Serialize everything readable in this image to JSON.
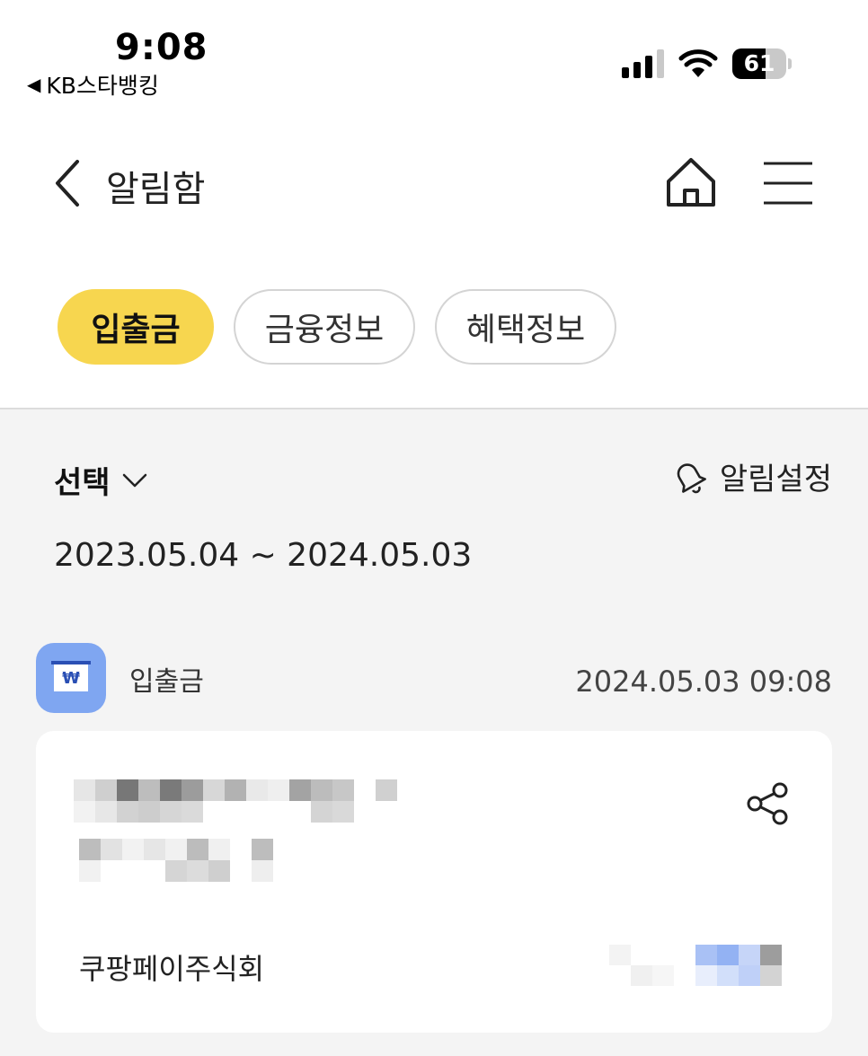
{
  "status_bar": {
    "time": "9:08",
    "back_app_label": "KB스타뱅킹",
    "battery_percent": "61",
    "signal_bars": 3,
    "icons": [
      "signal-icon",
      "wifi-icon",
      "battery-icon"
    ]
  },
  "header": {
    "title": "알림함",
    "icons": [
      "back-chevron-icon",
      "home-icon",
      "menu-icon"
    ]
  },
  "tabs": [
    {
      "label": "입출금",
      "active": true
    },
    {
      "label": "금융정보",
      "active": false
    },
    {
      "label": "혜택정보",
      "active": false
    }
  ],
  "filter": {
    "select_label": "선택",
    "alarm_settings_label": "알림설정",
    "date_range": "2023.05.04 ~ 2024.05.03"
  },
  "notifications": [
    {
      "category": "입출금",
      "timestamp": "2024.05.03 09:08",
      "merchant": "쿠팡페이주식회",
      "icon": "won-icon"
    }
  ],
  "colors": {
    "accent_yellow": "#f7d64f",
    "icon_blue": "#7fa6f1",
    "background": "#f4f4f4"
  }
}
